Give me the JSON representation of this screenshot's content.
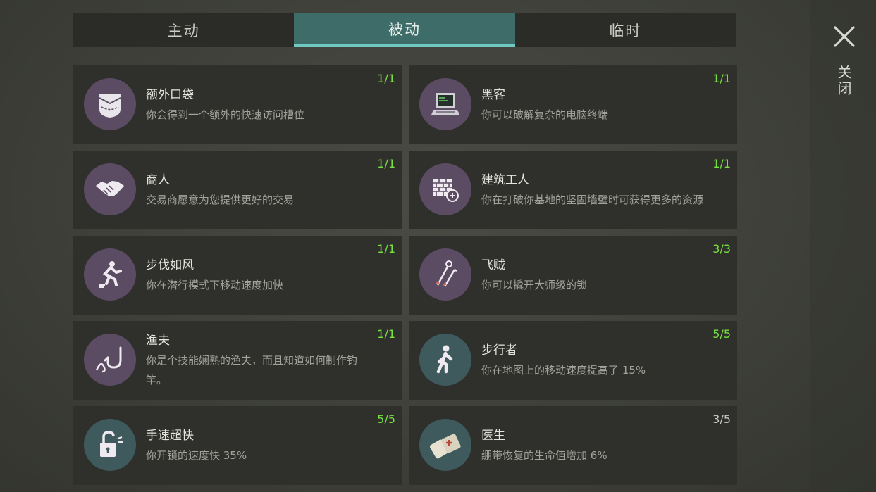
{
  "tabs": [
    {
      "label": "主动",
      "active": false
    },
    {
      "label": "被动",
      "active": true
    },
    {
      "label": "临时",
      "active": false
    }
  ],
  "close": {
    "label": "关闭"
  },
  "colors": {
    "accent": "#6fc8c2",
    "count_full": "#78e040",
    "icon_purple": "#5b4c64",
    "icon_teal": "#3e5a5c"
  },
  "perks": [
    {
      "title": "额外口袋",
      "desc": "你会得到一个额外的快速访问槽位",
      "count": "1/1",
      "icon": "pocket-icon",
      "color": "purple",
      "full": true
    },
    {
      "title": "黑客",
      "desc": "你可以破解复杂的电脑终端",
      "count": "1/1",
      "icon": "computer-icon",
      "color": "purple",
      "full": true
    },
    {
      "title": "商人",
      "desc": "交易商愿意为您提供更好的交易",
      "count": "1/1",
      "icon": "handshake-icon",
      "color": "purple",
      "full": true
    },
    {
      "title": "建筑工人",
      "desc": "你在打破你基地的坚固墙壁时可获得更多的资源",
      "count": "1/1",
      "icon": "brick-wall-icon",
      "color": "purple",
      "full": true
    },
    {
      "title": "步伐如风",
      "desc": "你在潜行模式下移动速度加快",
      "count": "1/1",
      "icon": "sneak-icon",
      "color": "purple",
      "full": true
    },
    {
      "title": "飞贼",
      "desc": "你可以撬开大师级的锁",
      "count": "3/3",
      "icon": "lockpick-icon",
      "color": "purple",
      "full": true
    },
    {
      "title": "渔夫",
      "desc": "你是个技能娴熟的渔夫，而且知道如何制作钓竿。",
      "count": "1/1",
      "icon": "fishhook-icon",
      "color": "purple",
      "full": true
    },
    {
      "title": "步行者",
      "desc": "你在地图上的移动速度提高了 15%",
      "count": "5/5",
      "icon": "walker-icon",
      "color": "teal",
      "full": true
    },
    {
      "title": "手速超快",
      "desc": "你开锁的速度快 35%",
      "count": "5/5",
      "icon": "unlock-icon",
      "color": "teal",
      "full": true
    },
    {
      "title": "医生",
      "desc": "绷带恢复的生命值增加 6%",
      "count": "3/5",
      "icon": "bandage-icon",
      "color": "teal",
      "full": false
    }
  ]
}
